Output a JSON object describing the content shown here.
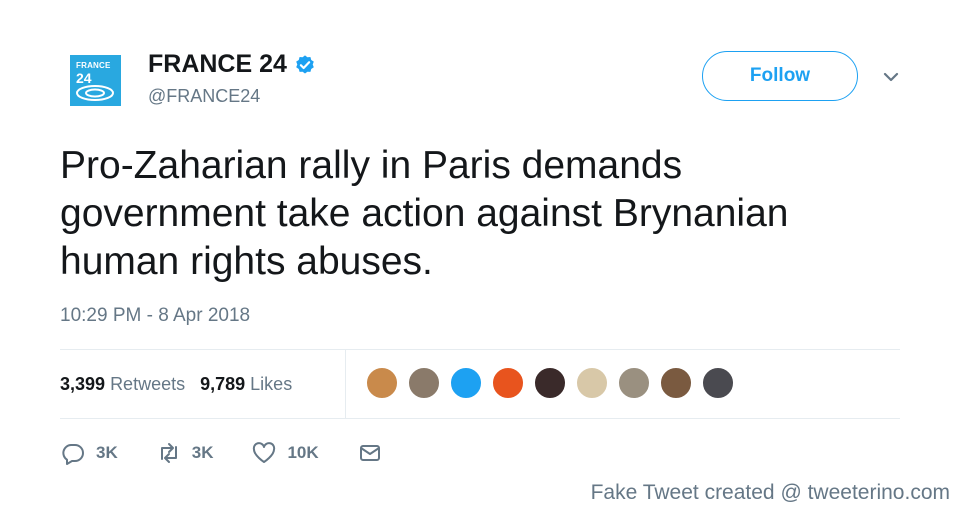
{
  "account": {
    "display_name": "FRANCE 24",
    "handle": "@FRANCE24",
    "verified": true,
    "avatar_logo_line1": "FRANCE",
    "avatar_logo_line2": "24",
    "avatar_color": "#29a8e0"
  },
  "follow_label": "Follow",
  "tweet": {
    "text": "Pro-Zaharian rally in Paris demands\ngovernment take action against Brynanian\nhuman rights abuses.",
    "timestamp": "10:29 PM - 8 Apr 2018"
  },
  "stats": {
    "retweets_count": "3,399",
    "retweets_label": "Retweets",
    "likes_count": "9,789",
    "likes_label": "Likes"
  },
  "liked_by_avatars": [
    {
      "color": "#c98a4b"
    },
    {
      "color": "#8a7a6a"
    },
    {
      "color": "#1da1f2"
    },
    {
      "color": "#e8541e"
    },
    {
      "color": "#3a2a2a"
    },
    {
      "color": "#d8c8a8"
    },
    {
      "color": "#9a9080"
    },
    {
      "color": "#7a5a40"
    },
    {
      "color": "#4a4a50"
    }
  ],
  "actions": {
    "reply_count": "3K",
    "retweet_count": "3K",
    "like_count": "10K"
  },
  "icons": [
    "verified-badge-icon",
    "chevron-down-icon",
    "reply-icon",
    "retweet-icon",
    "heart-icon",
    "envelope-icon"
  ],
  "colors": {
    "accent": "#1da1f2",
    "muted": "#657786",
    "text": "#14171a"
  },
  "credit": "Fake Tweet created @ tweeterino.com"
}
